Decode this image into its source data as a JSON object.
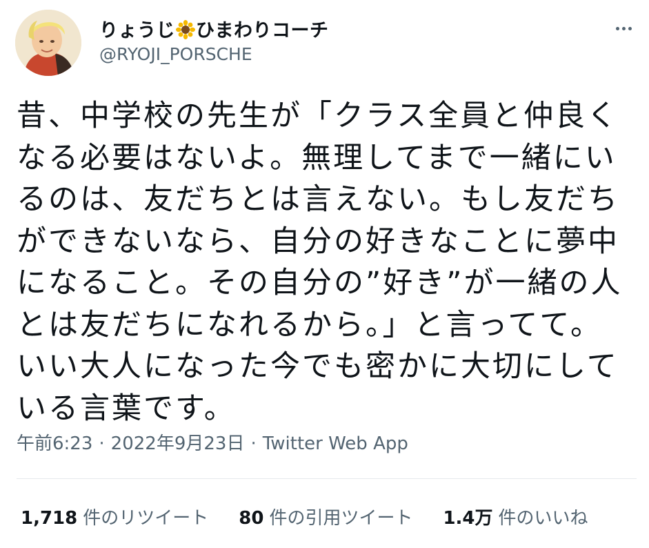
{
  "user": {
    "name_prefix": "りょうじ",
    "name_suffix": "ひまわりコーチ",
    "emoji_icon": "sunflower-icon",
    "handle": "@RYOJI_PORSCHE"
  },
  "tweet": {
    "lines": [
      "昔、中学校の先生が「クラス全員と仲良く",
      "なる必要はないよ。無理してまで一緒にい",
      "るのは、友だちとは言えない。もし友だち",
      "ができないなら、自分の好きなことに夢中",
      "になること。その自分の”好き”が一緒の人",
      "とは友だちになれるから。」と言ってて。",
      "いい大人になった今でも密かに大切にして",
      "いる言葉です。"
    ]
  },
  "meta": {
    "time": "午前6:23",
    "separator": "·",
    "date": "2022年9月23日",
    "source": "Twitter Web App"
  },
  "stats": [
    {
      "count": "1,718",
      "label": "件のリツイート"
    },
    {
      "count": "80",
      "label": "件の引用ツイート"
    },
    {
      "count": "1.4万",
      "label": "件のいいね"
    }
  ],
  "colors": {
    "text": "#0f1419",
    "secondary": "#536471",
    "divider": "#e6e9ec"
  }
}
